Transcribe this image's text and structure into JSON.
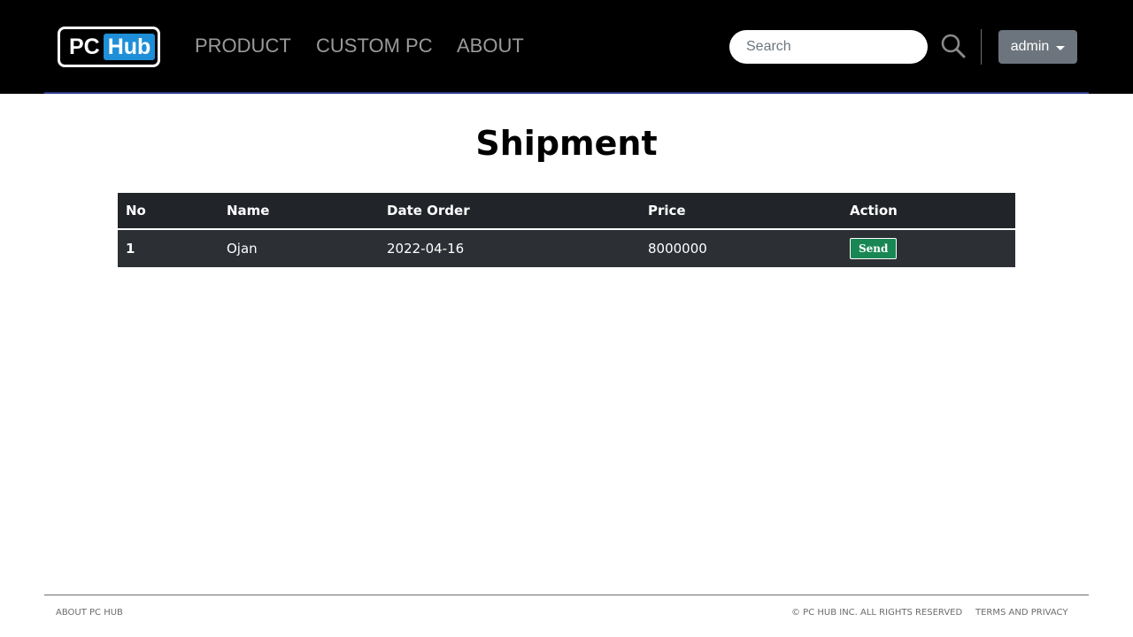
{
  "brand": {
    "pc": "PC",
    "hub": "Hub"
  },
  "nav": {
    "items": [
      "PRODUCT",
      "CUSTOM PC",
      "ABOUT"
    ]
  },
  "search": {
    "placeholder": "Search",
    "icon": "search-icon"
  },
  "user_menu": {
    "label": "admin"
  },
  "page": {
    "title": "Shipment"
  },
  "table": {
    "headers": [
      "No",
      "Name",
      "Date Order",
      "Price",
      "Action"
    ],
    "rows": [
      {
        "no": "1",
        "name": "Ojan",
        "date": "2022-04-16",
        "price": "8000000",
        "action": "Send"
      }
    ]
  },
  "footer": {
    "about": "ABOUT PC HUB",
    "copyright": "© PC HUB INC. ALL RIGHTS RESERVED",
    "terms": "TERMS AND PRIVACY"
  },
  "colors": {
    "navbar_bg": "#000000",
    "hub_accent": "#1e8fd8",
    "send_button": "#198754",
    "admin_button": "#6c757d",
    "table_header": "#212529"
  }
}
